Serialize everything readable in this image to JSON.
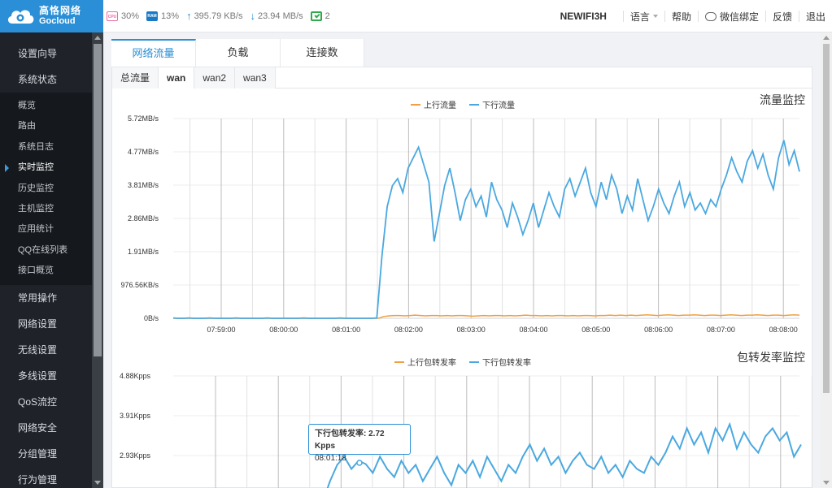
{
  "brand": {
    "name_cn": "高恪网络",
    "name_en": "Gocloud"
  },
  "topbar": {
    "cpu_label": "CPU",
    "cpu_value": "30%",
    "ram_label": "RAM",
    "ram_value": "13%",
    "upload": "395.79 KB/s",
    "download": "23.94 MB/s",
    "devices": "2",
    "model": "NEWIFI3H",
    "links": {
      "language": "语言",
      "help": "帮助",
      "wechat": "微信绑定",
      "feedback": "反馈",
      "logout": "退出"
    }
  },
  "sidebar": {
    "top_items": [
      "设置向导",
      "系统状态"
    ],
    "sub_items": [
      "概览",
      "路由",
      "系统日志",
      "实时监控",
      "历史监控",
      "主机监控",
      "应用统计",
      "QQ在线列表",
      "接口概览"
    ],
    "active_sub": "实时监控",
    "bottom_items": [
      "常用操作",
      "网络设置",
      "无线设置",
      "多线设置",
      "QoS流控",
      "网络安全",
      "分组管理",
      "行为管理"
    ]
  },
  "tabs": [
    "网络流量",
    "负载",
    "连接数"
  ],
  "subtabs": [
    "总流量",
    "wan",
    "wan2",
    "wan3"
  ],
  "colors": {
    "upload": "#f0a040",
    "download": "#4aa8e0",
    "accent": "#2a8fd6"
  },
  "chart_data": [
    {
      "type": "line",
      "title": "流量监控",
      "legend_position": "top-center",
      "grid": true,
      "yticks": [
        "0B/s",
        "976.56KB/s",
        "1.91MB/s",
        "2.86MB/s",
        "3.81MB/s",
        "4.77MB/s",
        "5.72MB/s"
      ],
      "ylim": [
        0,
        5.72
      ],
      "xticks": [
        "07:59:00",
        "08:00:00",
        "08:01:00",
        "08:02:00",
        "08:03:00",
        "08:04:00",
        "08:05:00",
        "08:06:00",
        "08:07:00",
        "08:08:00"
      ],
      "series": [
        {
          "name": "上行流量",
          "values": [
            0,
            0,
            0,
            0,
            0,
            0,
            0,
            0,
            0,
            0,
            0,
            0,
            0,
            0,
            0,
            0,
            0,
            0,
            0,
            0,
            0,
            0,
            0,
            0,
            0,
            0,
            0,
            0,
            0,
            0,
            0,
            0,
            0,
            0,
            0,
            0,
            0,
            0,
            0,
            0,
            0.05,
            0.07,
            0.08,
            0.08,
            0.07,
            0.08,
            0.09,
            0.08,
            0.07,
            0.08,
            0.08,
            0.07,
            0.08,
            0.07,
            0.08,
            0.08,
            0.07,
            0.06,
            0.07,
            0.08,
            0.07,
            0.08,
            0.08,
            0.07,
            0.08,
            0.07,
            0.08,
            0.09,
            0.08,
            0.08,
            0.07,
            0.08,
            0.07,
            0.08,
            0.08,
            0.07,
            0.08,
            0.07,
            0.08,
            0.08,
            0.07,
            0.08,
            0.08,
            0.09,
            0.08,
            0.09,
            0.08,
            0.09,
            0.08,
            0.09,
            0.1,
            0.09,
            0.08,
            0.09,
            0.1,
            0.09,
            0.08,
            0.09,
            0.09,
            0.1,
            0.09,
            0.08,
            0.09,
            0.09,
            0.08,
            0.09,
            0.1,
            0.09,
            0.08,
            0.09,
            0.09,
            0.1,
            0.09,
            0.08,
            0.09,
            0.09,
            0.08,
            0.09,
            0.1,
            0.09
          ]
        },
        {
          "name": "下行流量",
          "values": [
            0.01,
            0,
            0,
            0.01,
            0,
            0,
            0,
            0.01,
            0,
            0,
            0,
            0,
            0.01,
            0,
            0,
            0,
            0,
            0,
            0.01,
            0,
            0,
            0,
            0,
            0,
            0,
            0.01,
            0,
            0,
            0,
            0,
            0,
            0,
            0.01,
            0,
            0,
            0,
            0,
            0,
            0,
            0.01,
            1.8,
            3.2,
            3.8,
            4.0,
            3.6,
            4.3,
            4.6,
            4.9,
            4.4,
            3.9,
            2.2,
            3.0,
            3.8,
            4.3,
            3.6,
            2.8,
            3.4,
            3.7,
            3.2,
            3.5,
            2.9,
            3.9,
            3.4,
            3.1,
            2.6,
            3.3,
            2.9,
            2.4,
            2.8,
            3.3,
            2.6,
            3.1,
            3.6,
            3.2,
            2.9,
            3.7,
            4.0,
            3.5,
            3.9,
            4.3,
            3.6,
            3.2,
            3.9,
            3.4,
            4.1,
            3.7,
            3.0,
            3.5,
            3.1,
            4.0,
            3.4,
            2.8,
            3.2,
            3.7,
            3.3,
            3.0,
            3.5,
            3.9,
            3.2,
            3.6,
            3.1,
            3.3,
            3.0,
            3.4,
            3.2,
            3.7,
            4.1,
            4.6,
            4.2,
            3.9,
            4.5,
            4.8,
            4.3,
            4.7,
            4.1,
            3.7,
            4.6,
            5.1,
            4.4,
            4.8,
            4.2
          ]
        }
      ]
    },
    {
      "type": "line",
      "title": "包转发率监控",
      "legend_position": "top-center",
      "grid": true,
      "yticks": [
        "2.93Kpps",
        "3.91Kpps",
        "4.88Kpps"
      ],
      "ylim": [
        0,
        4.88
      ],
      "series": [
        {
          "name": "上行包转发率",
          "values": []
        },
        {
          "name": "下行包转发率",
          "values": [
            1.8,
            2.3,
            2.7,
            2.9,
            2.6,
            2.8,
            2.72,
            2.5,
            2.9,
            2.6,
            2.4,
            2.8,
            2.5,
            2.7,
            2.3,
            2.6,
            2.9,
            2.5,
            2.2,
            2.7,
            2.5,
            2.8,
            2.4,
            2.9,
            2.6,
            2.3,
            2.7,
            2.5,
            2.9,
            3.2,
            2.8,
            3.1,
            2.7,
            2.9,
            2.5,
            2.8,
            3.0,
            2.7,
            2.6,
            2.9,
            2.5,
            2.7,
            2.4,
            2.8,
            2.6,
            2.5,
            2.9,
            2.7,
            3.0,
            3.4,
            3.1,
            3.6,
            3.2,
            3.5,
            3.0,
            3.6,
            3.3,
            3.7,
            3.1,
            3.5,
            3.2,
            3.0,
            3.4,
            3.6,
            3.3,
            3.5,
            2.9,
            3.2
          ]
        }
      ]
    }
  ],
  "tooltip": {
    "label": "下行包转发率: 2.72 Kpps",
    "time": "08:01:18"
  }
}
